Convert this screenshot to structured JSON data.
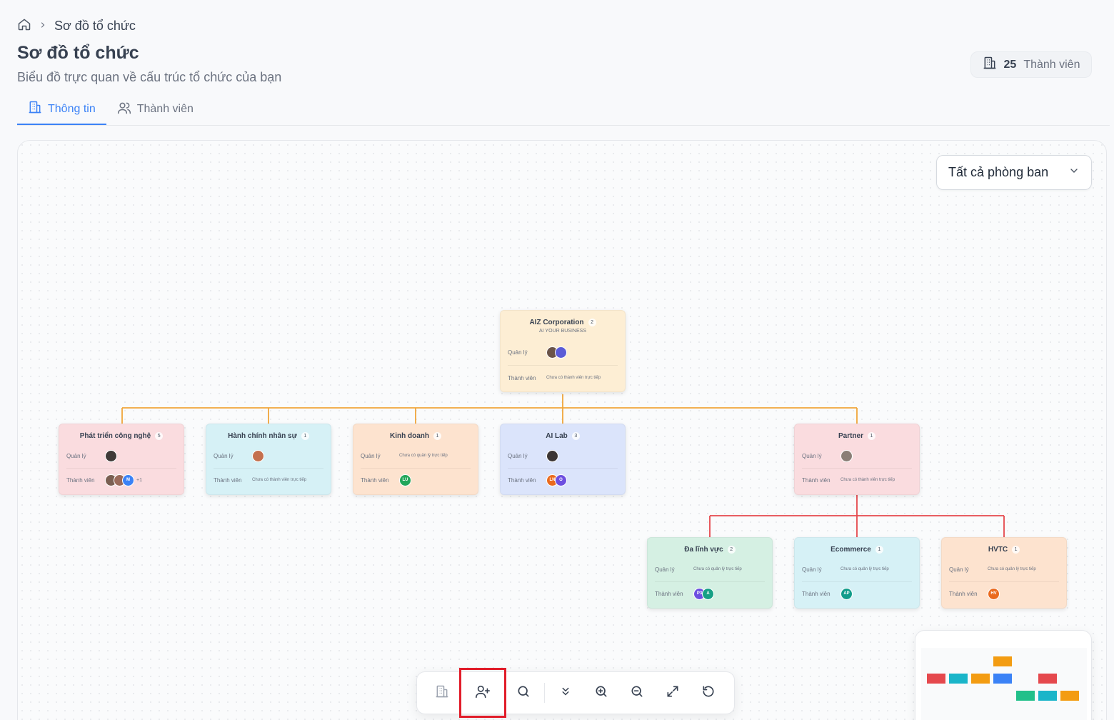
{
  "breadcrumb": {
    "current": "Sơ đồ tổ chức"
  },
  "header": {
    "title": "Sơ đồ tổ chức",
    "subtitle": "Biểu đồ trực quan về cấu trúc tổ chức của bạn",
    "member_count": "25",
    "member_label": "Thành viên"
  },
  "tabs": [
    {
      "label": "Thông tin",
      "active": true
    },
    {
      "label": "Thành viên",
      "active": false
    }
  ],
  "filter": {
    "selected": "Tất cả phòng ban"
  },
  "labels": {
    "manager": "Quản lý",
    "members": "Thành viên"
  },
  "nodes": {
    "root": {
      "name": "AIZ Corporation",
      "count": "2",
      "subtitle": "AI YOUR BUSINESS",
      "members_note": "Chưa có thành viên trực tiếp"
    },
    "tech": {
      "name": "Phát triển công nghệ",
      "count": "5",
      "members_more": "+1",
      "member_avatar_initial": "M"
    },
    "hr": {
      "name": "Hành chính nhân sự",
      "count": "1",
      "members_note": "Chưa có thành viên trực tiếp"
    },
    "sales": {
      "name": "Kinh doanh",
      "count": "1",
      "manager_note": "Chưa có quản lý trực tiếp",
      "member_initials": "LU"
    },
    "ailab": {
      "name": "AI Lab",
      "count": "3",
      "member_initials_1": "LN",
      "member_initials_2": "O"
    },
    "partner": {
      "name": "Partner",
      "count": "1",
      "members_note": "Chưa có thành viên trực tiếp"
    },
    "multi": {
      "name": "Đa lĩnh vực",
      "count": "2",
      "manager_note": "Chưa có quản lý trực tiếp",
      "member_initials_1": "P3",
      "member_initials_2": "A"
    },
    "ecom": {
      "name": "Ecommerce",
      "count": "1",
      "manager_note": "Chưa có quản lý trực tiếp",
      "member_initials": "AP"
    },
    "hvtc": {
      "name": "HVTC",
      "count": "1",
      "manager_note": "Chưa có quản lý trực tiếp",
      "member_initials": "HV"
    }
  },
  "colors": {
    "accent": "#3b82f6",
    "edge_primary": "#f0a53a",
    "edge_partner": "#e5484d",
    "highlight": "#e11d2a"
  },
  "toolbar": {
    "buttons": [
      "building-icon",
      "add-user-icon",
      "search-icon",
      "collapse-icon",
      "zoom-in-icon",
      "zoom-out-icon",
      "expand-icon",
      "reset-icon"
    ]
  }
}
